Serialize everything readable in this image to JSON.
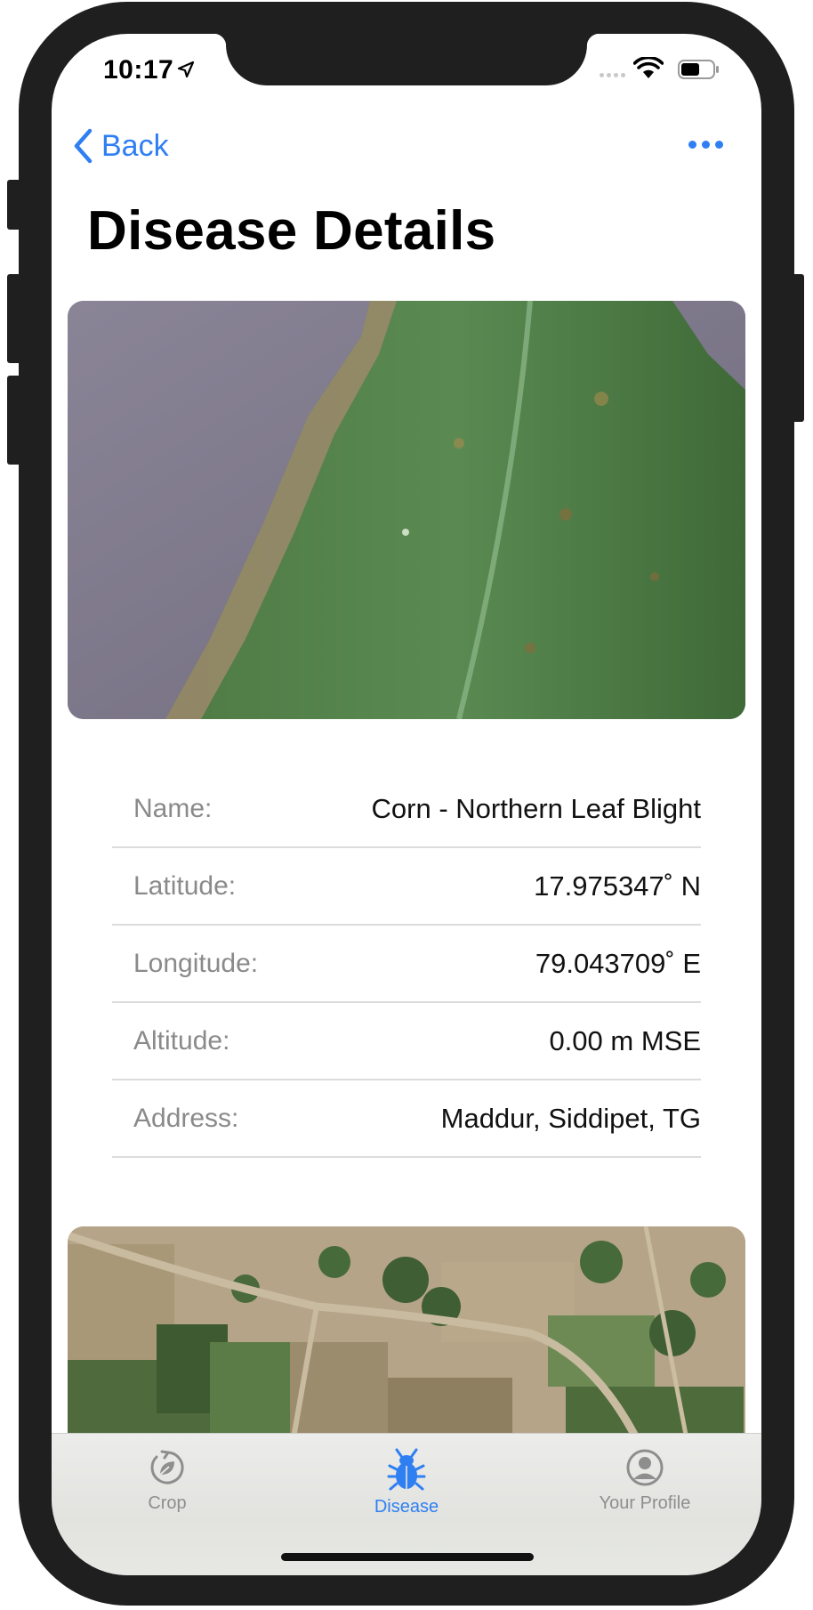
{
  "status_bar": {
    "time": "10:17"
  },
  "nav": {
    "back_label": "Back"
  },
  "page": {
    "title": "Disease Details"
  },
  "details": [
    {
      "label": "Name:",
      "value": "Corn - Northern Leaf Blight"
    },
    {
      "label": "Latitude:",
      "value": "17.975347˚ N"
    },
    {
      "label": "Longitude:",
      "value": "79.043709˚ E"
    },
    {
      "label": "Altitude:",
      "value": "0.00 m MSE"
    },
    {
      "label": "Address:",
      "value": "Maddur, Siddipet, TG"
    }
  ],
  "tabs": [
    {
      "label": "Crop",
      "icon": "crop-cycle-icon",
      "active": false
    },
    {
      "label": "Disease",
      "icon": "bug-icon",
      "active": true
    },
    {
      "label": "Your Profile",
      "icon": "profile-icon",
      "active": false
    }
  ],
  "colors": {
    "accent": "#2f7ff3",
    "inactive": "#8e8e8e",
    "frame": "#1f1f1f"
  }
}
